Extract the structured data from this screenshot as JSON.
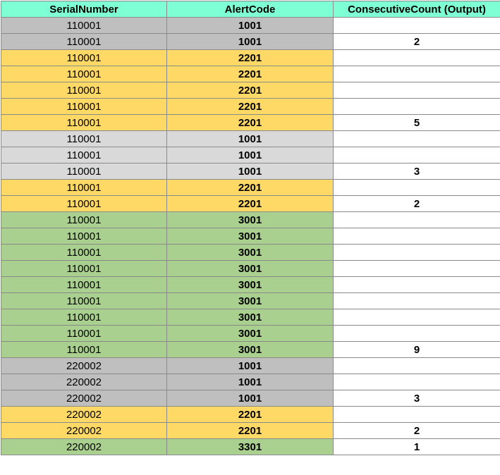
{
  "headers": [
    "SerialNumber",
    "AlertCode",
    "ConsecutiveCount (Output)"
  ],
  "colors": {
    "header": "#7fffd4",
    "gray_dark": "#bfbfbf",
    "gray_light": "#d9d9d9",
    "yellow": "#ffd966",
    "green": "#a9d08e",
    "white": "#ffffff"
  },
  "rows": [
    {
      "serial": "110001",
      "alert": "1001",
      "count": "",
      "color": "#bfbfbf"
    },
    {
      "serial": "110001",
      "alert": "1001",
      "count": "2",
      "color": "#bfbfbf"
    },
    {
      "serial": "110001",
      "alert": "2201",
      "count": "",
      "color": "#ffd966"
    },
    {
      "serial": "110001",
      "alert": "2201",
      "count": "",
      "color": "#ffd966"
    },
    {
      "serial": "110001",
      "alert": "2201",
      "count": "",
      "color": "#ffd966"
    },
    {
      "serial": "110001",
      "alert": "2201",
      "count": "",
      "color": "#ffd966"
    },
    {
      "serial": "110001",
      "alert": "2201",
      "count": "5",
      "color": "#ffd966"
    },
    {
      "serial": "110001",
      "alert": "1001",
      "count": "",
      "color": "#d9d9d9"
    },
    {
      "serial": "110001",
      "alert": "1001",
      "count": "",
      "color": "#d9d9d9"
    },
    {
      "serial": "110001",
      "alert": "1001",
      "count": "3",
      "color": "#d9d9d9"
    },
    {
      "serial": "110001",
      "alert": "2201",
      "count": "",
      "color": "#ffd966"
    },
    {
      "serial": "110001",
      "alert": "2201",
      "count": "2",
      "color": "#ffd966"
    },
    {
      "serial": "110001",
      "alert": "3001",
      "count": "",
      "color": "#a9d08e"
    },
    {
      "serial": "110001",
      "alert": "3001",
      "count": "",
      "color": "#a9d08e"
    },
    {
      "serial": "110001",
      "alert": "3001",
      "count": "",
      "color": "#a9d08e"
    },
    {
      "serial": "110001",
      "alert": "3001",
      "count": "",
      "color": "#a9d08e"
    },
    {
      "serial": "110001",
      "alert": "3001",
      "count": "",
      "color": "#a9d08e"
    },
    {
      "serial": "110001",
      "alert": "3001",
      "count": "",
      "color": "#a9d08e"
    },
    {
      "serial": "110001",
      "alert": "3001",
      "count": "",
      "color": "#a9d08e"
    },
    {
      "serial": "110001",
      "alert": "3001",
      "count": "",
      "color": "#a9d08e"
    },
    {
      "serial": "110001",
      "alert": "3001",
      "count": "9",
      "color": "#a9d08e"
    },
    {
      "serial": "220002",
      "alert": "1001",
      "count": "",
      "color": "#bfbfbf"
    },
    {
      "serial": "220002",
      "alert": "1001",
      "count": "",
      "color": "#bfbfbf"
    },
    {
      "serial": "220002",
      "alert": "1001",
      "count": "3",
      "color": "#bfbfbf"
    },
    {
      "serial": "220002",
      "alert": "2201",
      "count": "",
      "color": "#ffd966"
    },
    {
      "serial": "220002",
      "alert": "2201",
      "count": "2",
      "color": "#ffd966"
    },
    {
      "serial": "220002",
      "alert": "3301",
      "count": "1",
      "color": "#a9d08e"
    }
  ]
}
